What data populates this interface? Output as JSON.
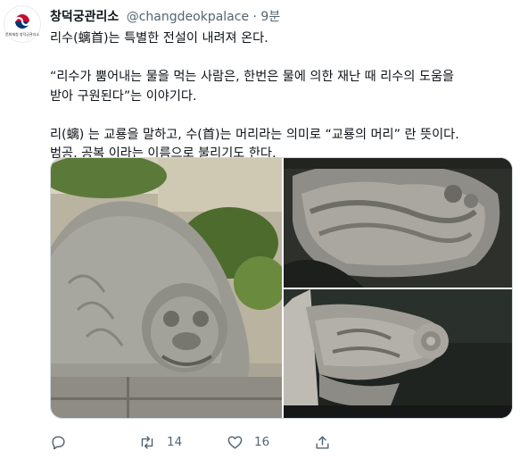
{
  "account": {
    "display_name": "창덕궁관리소",
    "handle": "@changdeokpalace",
    "separator": "·",
    "time": "9분",
    "avatar_icon": "korean-government-emblem-icon",
    "avatar_text": "문화재청 창덕궁관리소"
  },
  "tweet": {
    "lines": [
      "리수(螭首)는 특별한 전설이 내려져 온다.",
      "",
      "“리수가 뿜어내는 물을 먹는 사람은, 한번은 물에 의한 재난 때 리수의 도움을",
      "받아 구원된다”는 이야기다.",
      "",
      "리(螭) 는 교룡을 말하고, 수(首)는 머리라는 의미로 “교룡의 머리” 란 뜻이다.",
      "범공, 공복 이라는 이름으로 불리기도 한다."
    ]
  },
  "media": {
    "images": [
      {
        "name": "stone-creature-head-photo",
        "description_icon": "photo-icon"
      },
      {
        "name": "carved-dragon-relief-photo",
        "description_icon": "photo-icon"
      },
      {
        "name": "stone-dragon-spout-photo",
        "description_icon": "photo-icon"
      }
    ]
  },
  "actions": {
    "reply": {
      "icon": "reply-icon",
      "count": ""
    },
    "retweet": {
      "icon": "retweet-icon",
      "count": "14"
    },
    "like": {
      "icon": "heart-icon",
      "count": "16"
    },
    "share": {
      "icon": "share-icon",
      "count": ""
    }
  },
  "colors": {
    "text_primary": "#0f1419",
    "text_secondary": "#536471",
    "border": "#cfd9de"
  }
}
